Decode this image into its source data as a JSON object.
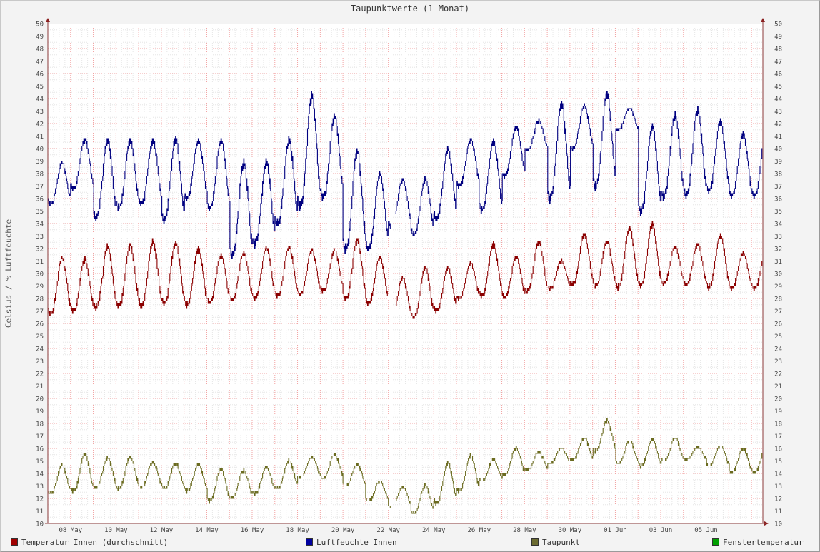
{
  "chart_data": {
    "type": "line",
    "title": "Taupunktwerte (1 Monat)",
    "ylabel": "Celsius / % Luftfeuchte",
    "ylim": [
      10,
      50
    ],
    "yticks": [
      "10",
      "11",
      "12",
      "13",
      "14",
      "15",
      "16",
      "17",
      "18",
      "19",
      "20",
      "21",
      "22",
      "23",
      "24",
      "25",
      "26",
      "27",
      "28",
      "29",
      "30",
      "31",
      "32",
      "33",
      "34",
      "35",
      "36",
      "37",
      "38",
      "39",
      "40",
      "41",
      "42",
      "43",
      "44",
      "45",
      "46",
      "47",
      "48",
      "49",
      "50"
    ],
    "xlim": [
      0,
      31.5
    ],
    "xticks": [
      {
        "label": "08 May",
        "x": 1.0
      },
      {
        "label": "10 May",
        "x": 3.0
      },
      {
        "label": "12 May",
        "x": 5.0
      },
      {
        "label": "14 May",
        "x": 7.0
      },
      {
        "label": "16 May",
        "x": 9.0
      },
      {
        "label": "18 May",
        "x": 11.0
      },
      {
        "label": "20 May",
        "x": 13.0
      },
      {
        "label": "22 May",
        "x": 15.0
      },
      {
        "label": "24 May",
        "x": 17.0
      },
      {
        "label": "26 May",
        "x": 19.0
      },
      {
        "label": "28 May",
        "x": 21.0
      },
      {
        "label": "30 May",
        "x": 23.0
      },
      {
        "label": "01 Jun",
        "x": 25.0
      },
      {
        "label": "03 Jun",
        "x": 27.0
      },
      {
        "label": "05 Jun",
        "x": 29.0
      }
    ],
    "grid": true,
    "legend_position": "bottom",
    "series": [
      {
        "name": "Temperatur Innen (durchschnitt)",
        "color": "#8b0000",
        "daily_min": [
          26.8,
          27.0,
          27.3,
          27.4,
          27.4,
          27.6,
          27.5,
          27.7,
          27.9,
          28.0,
          28.2,
          28.3,
          28.6,
          28.0,
          27.6,
          26.5,
          26.5,
          27.0,
          28.0,
          28.2,
          28.1,
          28.6,
          28.8,
          29.1,
          29.0,
          28.9,
          29.0,
          29.2,
          29.1,
          28.9,
          28.8
        ],
        "daily_max": [
          31.2,
          31.1,
          32.1,
          32.2,
          32.5,
          32.4,
          31.9,
          31.4,
          31.6,
          32.0,
          32.1,
          31.9,
          31.8,
          32.6,
          31.3,
          29.6,
          30.4,
          30.4,
          30.8,
          32.3,
          31.3,
          32.5,
          31.0,
          33.1,
          32.5,
          33.6,
          33.9,
          32.1,
          32.3,
          33.0,
          31.6
        ],
        "gap": [
          15.0,
          15.3
        ]
      },
      {
        "name": "Luftfeuchte Innen",
        "color": "#000080",
        "daily_min": [
          35.6,
          36.8,
          34.5,
          35.3,
          35.6,
          34.3,
          36.0,
          35.2,
          31.5,
          32.4,
          34.0,
          35.4,
          36.1,
          32.0,
          32.0,
          33.8,
          33.1,
          34.4,
          37.0,
          35.1,
          37.8,
          39.9,
          36.0,
          40.0,
          37.0,
          41.5,
          35.0,
          36.2,
          36.3,
          36.6,
          36.2
        ],
        "daily_max": [
          38.8,
          40.7,
          40.6,
          40.6,
          40.6,
          40.7,
          40.6,
          40.6,
          38.8,
          38.8,
          40.6,
          44.2,
          42.5,
          39.7,
          37.9,
          37.5,
          37.5,
          39.9,
          40.7,
          40.5,
          41.7,
          42.2,
          43.5,
          43.4,
          44.3,
          43.2,
          41.7,
          42.6,
          43.0,
          42.1,
          41.1
        ],
        "gap": [
          15.1,
          15.3
        ]
      },
      {
        "name": "Taupunkt",
        "color": "#6b6b20",
        "daily_min": [
          12.4,
          12.6,
          12.9,
          12.8,
          12.9,
          12.8,
          12.6,
          11.8,
          12.1,
          12.4,
          12.8,
          13.7,
          13.6,
          13.0,
          11.8,
          11.3,
          10.8,
          11.6,
          12.6,
          13.4,
          13.9,
          14.3,
          14.8,
          15.1,
          15.8,
          14.8,
          14.6,
          15.0,
          15.1,
          14.6,
          14.1
        ],
        "daily_max": [
          14.6,
          15.5,
          15.2,
          15.3,
          14.9,
          14.8,
          14.7,
          14.3,
          14.2,
          14.5,
          15.0,
          15.3,
          15.5,
          14.7,
          13.4,
          12.9,
          13.0,
          14.8,
          15.4,
          15.1,
          16.0,
          15.7,
          16.0,
          16.8,
          18.2,
          16.6,
          16.7,
          16.8,
          16.1,
          16.2,
          16.0
        ],
        "gap": [
          15.1,
          15.3
        ]
      },
      {
        "name": "Fenstertemperatur",
        "color": "#00aa00"
      }
    ]
  }
}
